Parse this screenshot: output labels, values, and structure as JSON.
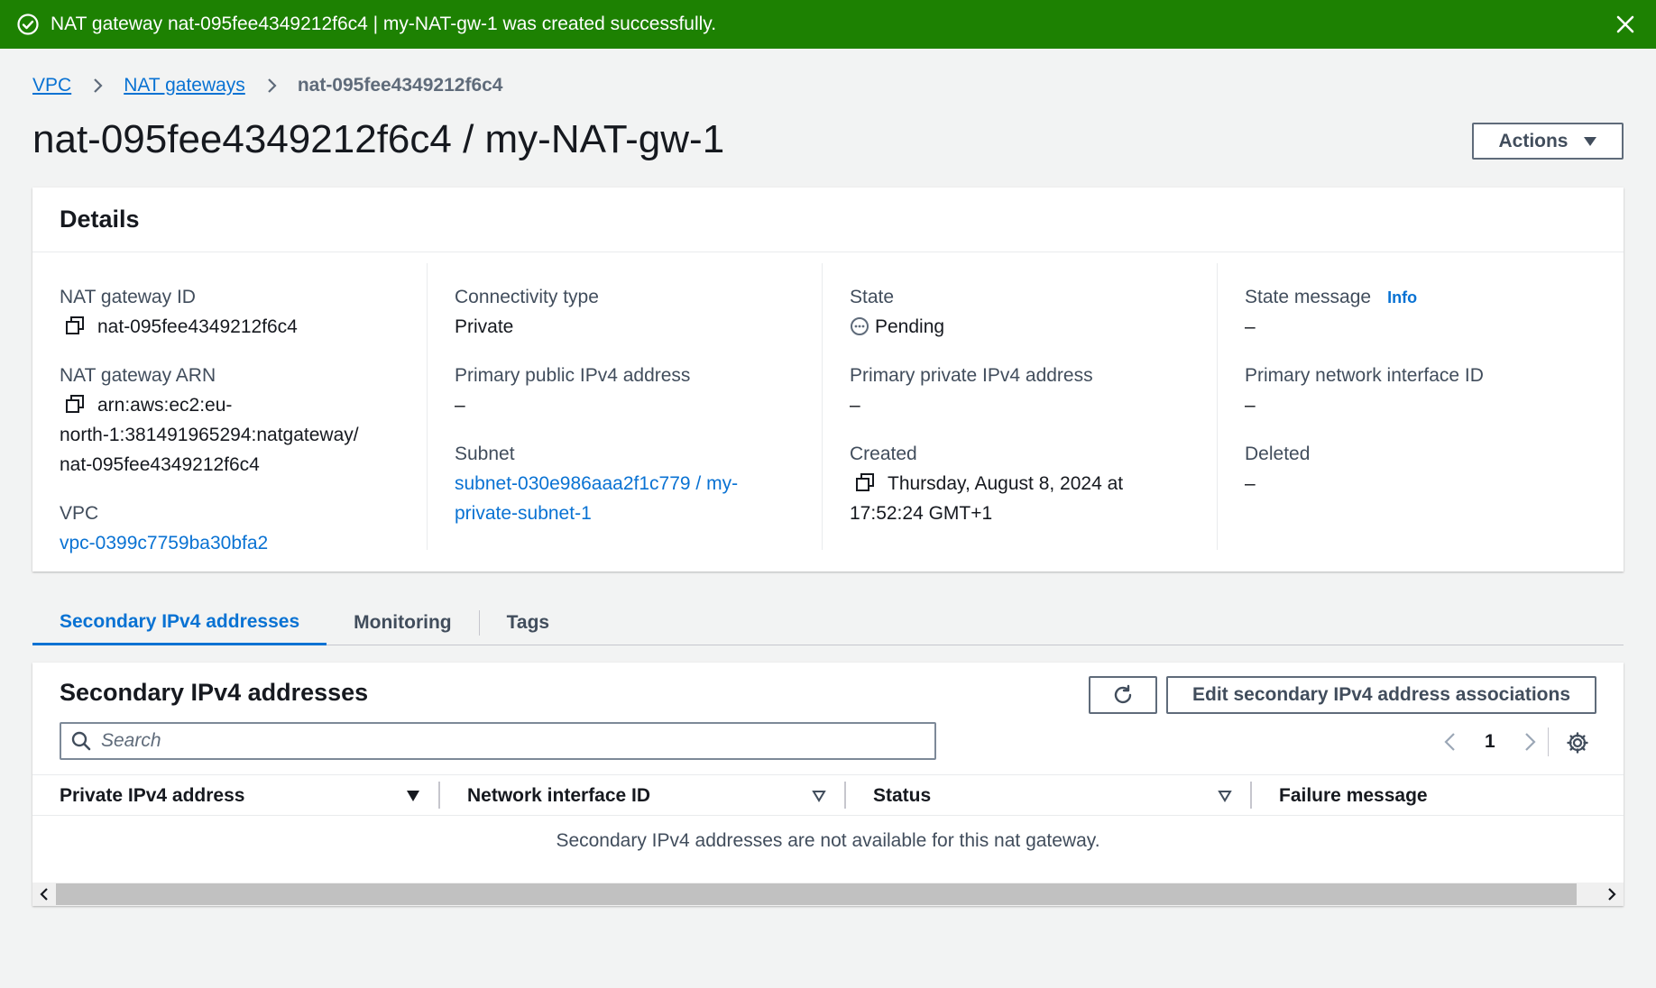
{
  "flash": {
    "message": "NAT gateway nat-095fee4349212f6c4 | my-NAT-gw-1 was created successfully."
  },
  "breadcrumb": {
    "items": [
      "VPC",
      "NAT gateways"
    ],
    "current": "nat-095fee4349212f6c4"
  },
  "page": {
    "title": "nat-095fee4349212f6c4 / my-NAT-gw-1",
    "actions_label": "Actions"
  },
  "details": {
    "title": "Details",
    "nat_gateway_id_label": "NAT gateway ID",
    "nat_gateway_id": "nat-095fee4349212f6c4",
    "nat_gateway_arn_label": "NAT gateway ARN",
    "nat_gateway_arn_line1": "arn:aws:ec2:eu-",
    "nat_gateway_arn_line2": "north-1:381491965294:natgateway/",
    "nat_gateway_arn_line3": "nat-095fee4349212f6c4",
    "vpc_label": "VPC",
    "vpc": "vpc-0399c7759ba30bfa2",
    "connectivity_type_label": "Connectivity type",
    "connectivity_type": "Private",
    "primary_public_ipv4_label": "Primary public IPv4 address",
    "primary_public_ipv4": "–",
    "subnet_label": "Subnet",
    "subnet_line1": "subnet-030e986aaa2f1c779 / my-",
    "subnet_line2": "private-subnet-1",
    "state_label": "State",
    "state": "Pending",
    "primary_private_ipv4_label": "Primary private IPv4 address",
    "primary_private_ipv4": "–",
    "created_label": "Created",
    "created_line1": "Thursday, August 8, 2024 at",
    "created_line2": "17:52:24 GMT+1",
    "state_message_label": "State message",
    "info_label": "Info",
    "state_message": "–",
    "primary_eni_label": "Primary network interface ID",
    "primary_eni": "–",
    "deleted_label": "Deleted",
    "deleted": "–"
  },
  "tabs": [
    "Secondary IPv4 addresses",
    "Monitoring",
    "Tags"
  ],
  "secondary": {
    "title": "Secondary IPv4 addresses",
    "edit_label": "Edit secondary IPv4 address associations",
    "search_placeholder": "Search",
    "page_number": "1",
    "columns": [
      "Private IPv4 address",
      "Network interface ID",
      "Status",
      "Failure message"
    ],
    "empty_message": "Secondary IPv4 addresses are not available for this nat gateway."
  },
  "colors": {
    "flash_success": "#1d8102",
    "link": "#0972d3",
    "background": "#f2f3f3"
  }
}
